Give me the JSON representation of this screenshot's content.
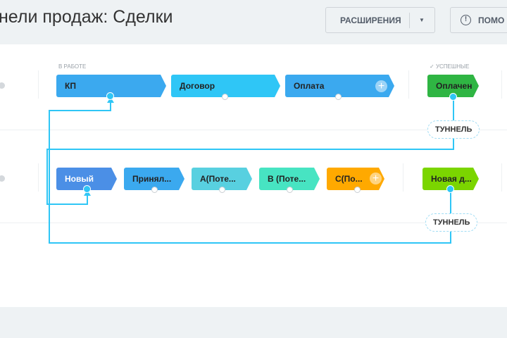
{
  "header": {
    "title": "нели продаж: Сделки",
    "extensions_label": "РАСШИРЕНИЯ",
    "help_label": "ПОМО"
  },
  "pipeline1": {
    "in_work_label": "В РАБОТЕ",
    "success_label": "УСПЕШНЫЕ",
    "stages": [
      {
        "name": "КП",
        "color": "#3ba9ef"
      },
      {
        "name": "Договор",
        "color": "#2fc6f6"
      },
      {
        "name": "Оплата",
        "color": "#3ba9ef"
      }
    ],
    "success_stage": {
      "name": "Оплачен",
      "color": "#2fb543"
    },
    "tunnel_label": "ТУННЕЛЬ"
  },
  "pipeline2": {
    "stages": [
      {
        "name": "Новый",
        "color": "#4b8fe6"
      },
      {
        "name": "Принял...",
        "color": "#3ba9ef"
      },
      {
        "name": "А(Поте...",
        "color": "#58d0e0"
      },
      {
        "name": "В (Поте...",
        "color": "#47e4c2"
      },
      {
        "name": "С(По...",
        "color": "#ffa900"
      }
    ],
    "success_stage": {
      "name": "Новая д...",
      "color": "#7bd500"
    },
    "tunnel_label": "ТУННЕЛЬ"
  }
}
